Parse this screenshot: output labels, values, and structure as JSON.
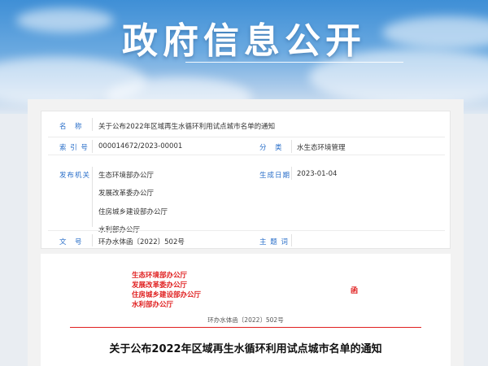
{
  "banner": {
    "title": "政府信息公开"
  },
  "info": {
    "name_label": "名　称",
    "name_value": "关于公布2022年区域再生水循环利用试点城市名单的通知",
    "index_label": "索 引 号",
    "index_value": "000014672/2023-00001",
    "category_label": "分　类",
    "category_value": "水生态环境管理",
    "publisher_label": "发布机关",
    "publishers": [
      "生态环境部办公厅",
      "发展改革委办公厅",
      "住房城乡建设部办公厅",
      "水利部办公厅"
    ],
    "date_label": "生成日期",
    "date_value": "2023-01-04",
    "docno_label": "文　号",
    "docno_value": "环办水体函〔2022〕502号",
    "subject_label": "主 题 词",
    "subject_value": ""
  },
  "document": {
    "issuers": [
      "生态环境部办公厅",
      "发展改革委办公厅",
      "住房城乡建设部办公厅",
      "水利部办公厅"
    ],
    "han": "函",
    "doc_number": "环办水体函〔2022〕502号",
    "title": "关于公布2022年区域再生水循环利用试点城市名单的通知"
  },
  "colors": {
    "label_blue": "#2a6fc9",
    "red": "#e02020",
    "banner_blue": "#3f8fd6"
  }
}
